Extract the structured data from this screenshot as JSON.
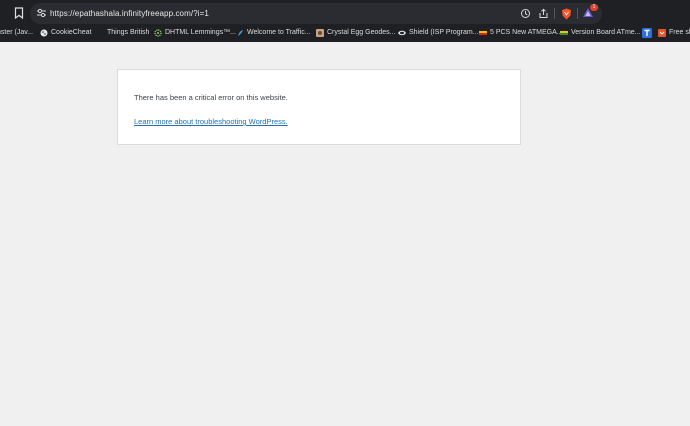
{
  "browser": {
    "url": "https://epathashala.infinityfreeapp.com/?i=1",
    "rewards_badge": "1",
    "bookmarks": [
      {
        "label": "nster (Jav..."
      },
      {
        "label": "CookieCheat"
      },
      {
        "label": "Things British"
      },
      {
        "label": "DHTML Lemmings™..."
      },
      {
        "label": "Welcome to Traffic..."
      },
      {
        "label": "Crystal Egg Geodes..."
      },
      {
        "label": "Shield (ISP Program..."
      },
      {
        "label": "5 PCS New ATMEGA..."
      },
      {
        "label": "Version Board ATme..."
      },
      {
        "label": ""
      },
      {
        "label": "Free sh"
      }
    ]
  },
  "page": {
    "error_message": "There has been a critical error on this website.",
    "help_link": "Learn more about troubleshooting WordPress."
  },
  "colors": {
    "chrome_bg": "#1f2024",
    "url_bar_bg": "#2b2c31",
    "page_bg": "#f0f0f1",
    "link": "#2271b1",
    "text": "#3c434a"
  }
}
